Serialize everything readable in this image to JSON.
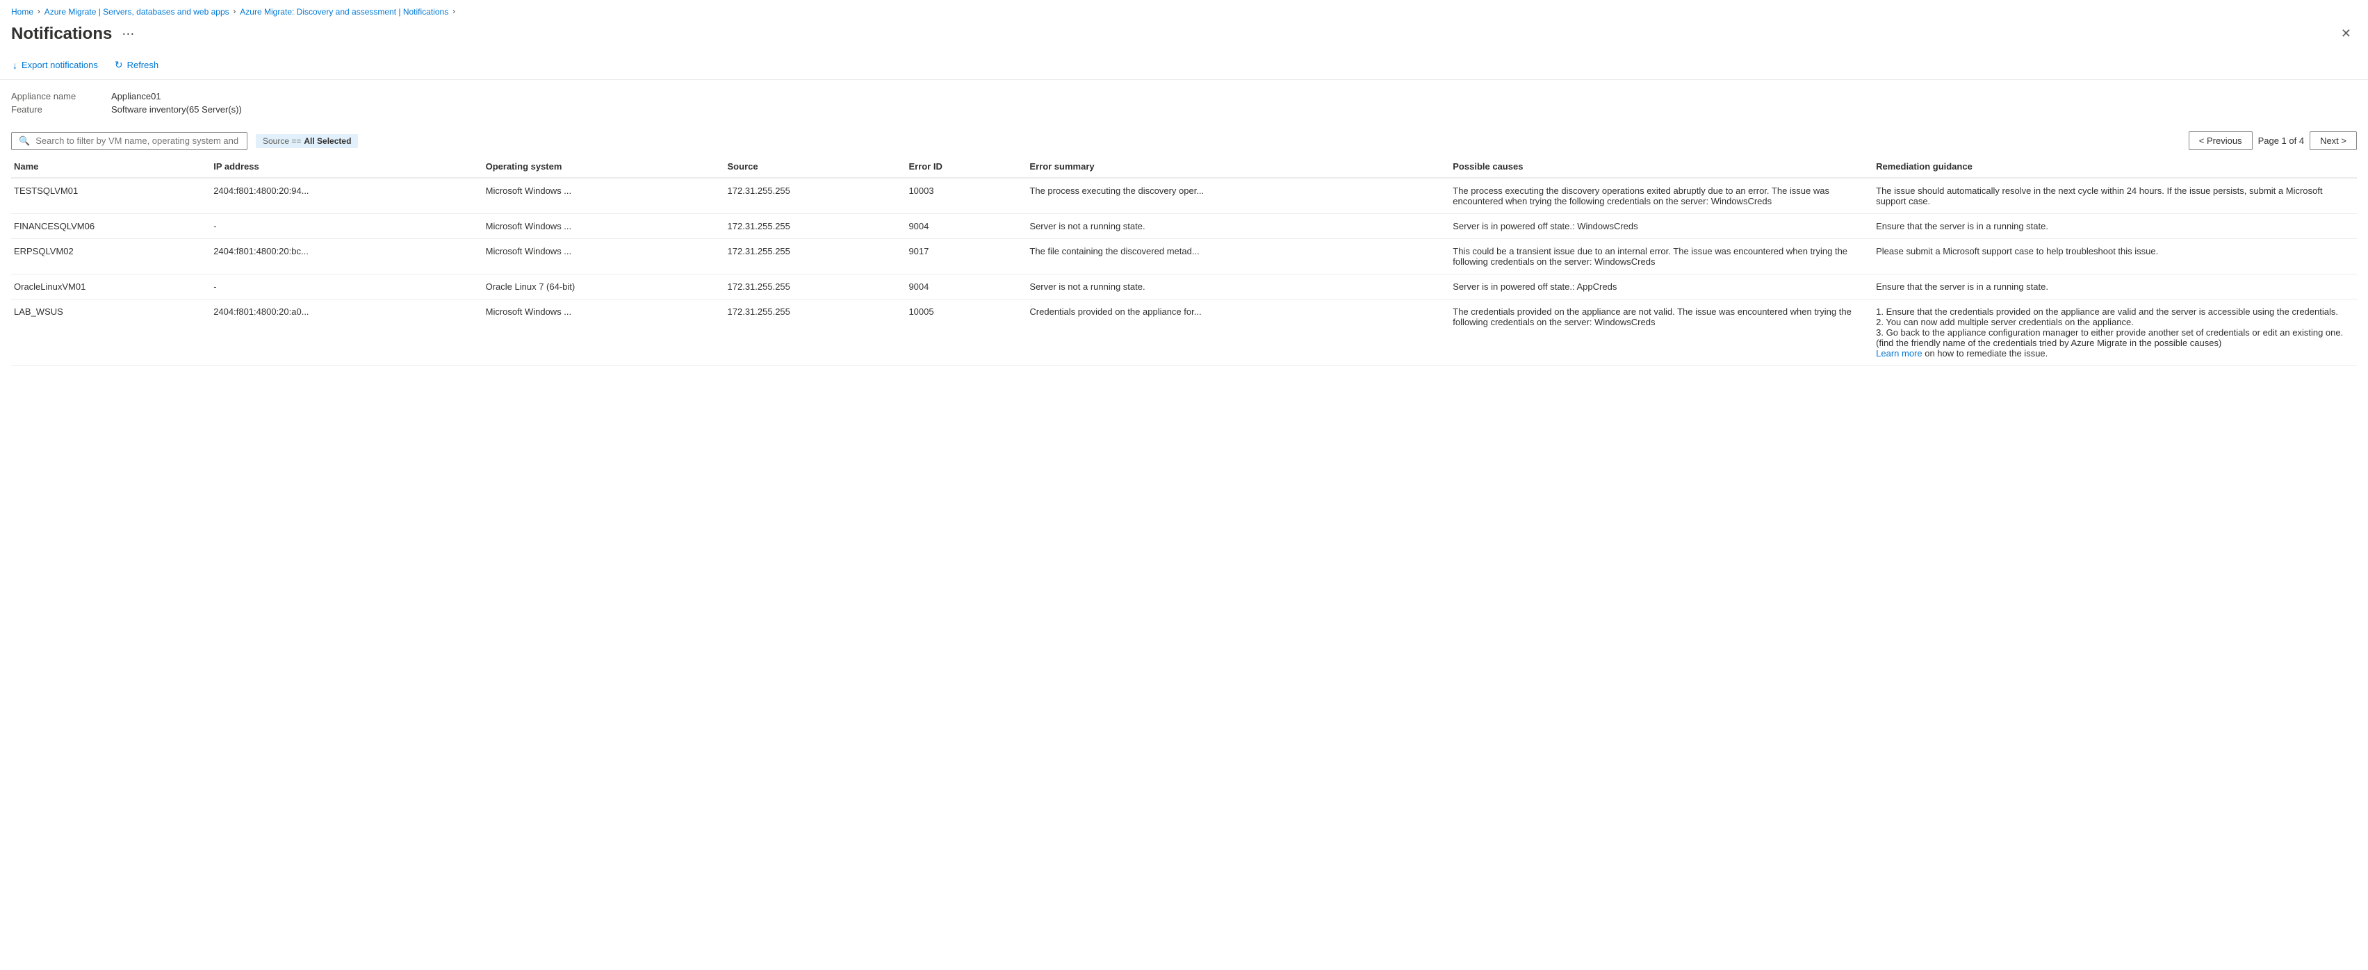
{
  "breadcrumb": {
    "items": [
      {
        "label": "Home",
        "href": true
      },
      {
        "label": "Azure Migrate | Servers, databases and web apps",
        "href": true
      },
      {
        "label": "Azure Migrate: Discovery and assessment | Notifications",
        "href": true
      }
    ]
  },
  "header": {
    "title": "Notifications",
    "more_label": "···",
    "close_label": "✕"
  },
  "toolbar": {
    "export_label": "Export notifications",
    "refresh_label": "Refresh"
  },
  "metadata": {
    "appliance_label": "Appliance name",
    "appliance_value": "Appliance01",
    "feature_label": "Feature",
    "feature_value": "Software inventory(65 Server(s))"
  },
  "search": {
    "placeholder": "Search to filter by VM name, operating system and error ID"
  },
  "filter": {
    "prefix": "Source ==",
    "value": "All Selected"
  },
  "pagination": {
    "previous_label": "< Previous",
    "page_info": "Page 1 of 4",
    "next_label": "Next >"
  },
  "table": {
    "columns": [
      "Name",
      "IP address",
      "Operating system",
      "Source",
      "Error ID",
      "Error summary",
      "Possible causes",
      "Remediation guidance"
    ],
    "rows": [
      {
        "name": "TESTSQLVM01",
        "ip": "2404:f801:4800:20:94...",
        "os": "Microsoft Windows ...",
        "source": "172.31.255.255",
        "errorId": "10003",
        "summary": "The process executing the discovery oper...",
        "causes": "The process executing the discovery operations exited abruptly due to an error. The issue was encountered when trying the following credentials on the server: WindowsCreds",
        "remediation": "The issue should automatically resolve in the next cycle within 24 hours. If the issue persists, submit a Microsoft support case.",
        "learnMore": false
      },
      {
        "name": "FINANCESQLVM06",
        "ip": "-",
        "os": "Microsoft Windows ...",
        "source": "172.31.255.255",
        "errorId": "9004",
        "summary": "Server is not a running state.",
        "causes": "Server is in powered off state.: WindowsCreds",
        "remediation": "Ensure that the server is in a running state.",
        "learnMore": false
      },
      {
        "name": "ERPSQLVM02",
        "ip": "2404:f801:4800:20:bc...",
        "os": "Microsoft Windows ...",
        "source": "172.31.255.255",
        "errorId": "9017",
        "summary": "The file containing the discovered metad...",
        "causes": "This could be a transient issue due to an internal error. The issue was encountered when trying the following credentials on the server: WindowsCreds",
        "remediation": "Please submit a Microsoft support case to help troubleshoot this issue.",
        "learnMore": false
      },
      {
        "name": "OracleLinuxVM01",
        "ip": "-",
        "os": "Oracle Linux 7 (64-bit)",
        "source": "172.31.255.255",
        "errorId": "9004",
        "summary": "Server is not a running state.",
        "causes": "Server is in powered off state.: AppCreds",
        "remediation": "Ensure that the server is in a running state.",
        "learnMore": false
      },
      {
        "name": "LAB_WSUS",
        "ip": "2404:f801:4800:20:a0...",
        "os": "Microsoft Windows ...",
        "source": "172.31.255.255",
        "errorId": "10005",
        "summary": "Credentials provided on the appliance for...",
        "causes": "The credentials provided on the appliance are not valid. The issue was encountered when trying the following credentials on the server: WindowsCreds",
        "remediation": "1. Ensure that the credentials provided on the appliance are valid and the server is accessible using the credentials.\n2. You can now add multiple server credentials on the appliance.\n3. Go back to the appliance configuration manager to either provide another set of credentials or edit an existing one. (find the friendly name of the credentials tried by Azure Migrate in the possible causes)",
        "learnMoreText": "Learn more",
        "learnMoreSuffix": " on how to remediate the issue.",
        "learnMore": true
      }
    ]
  }
}
